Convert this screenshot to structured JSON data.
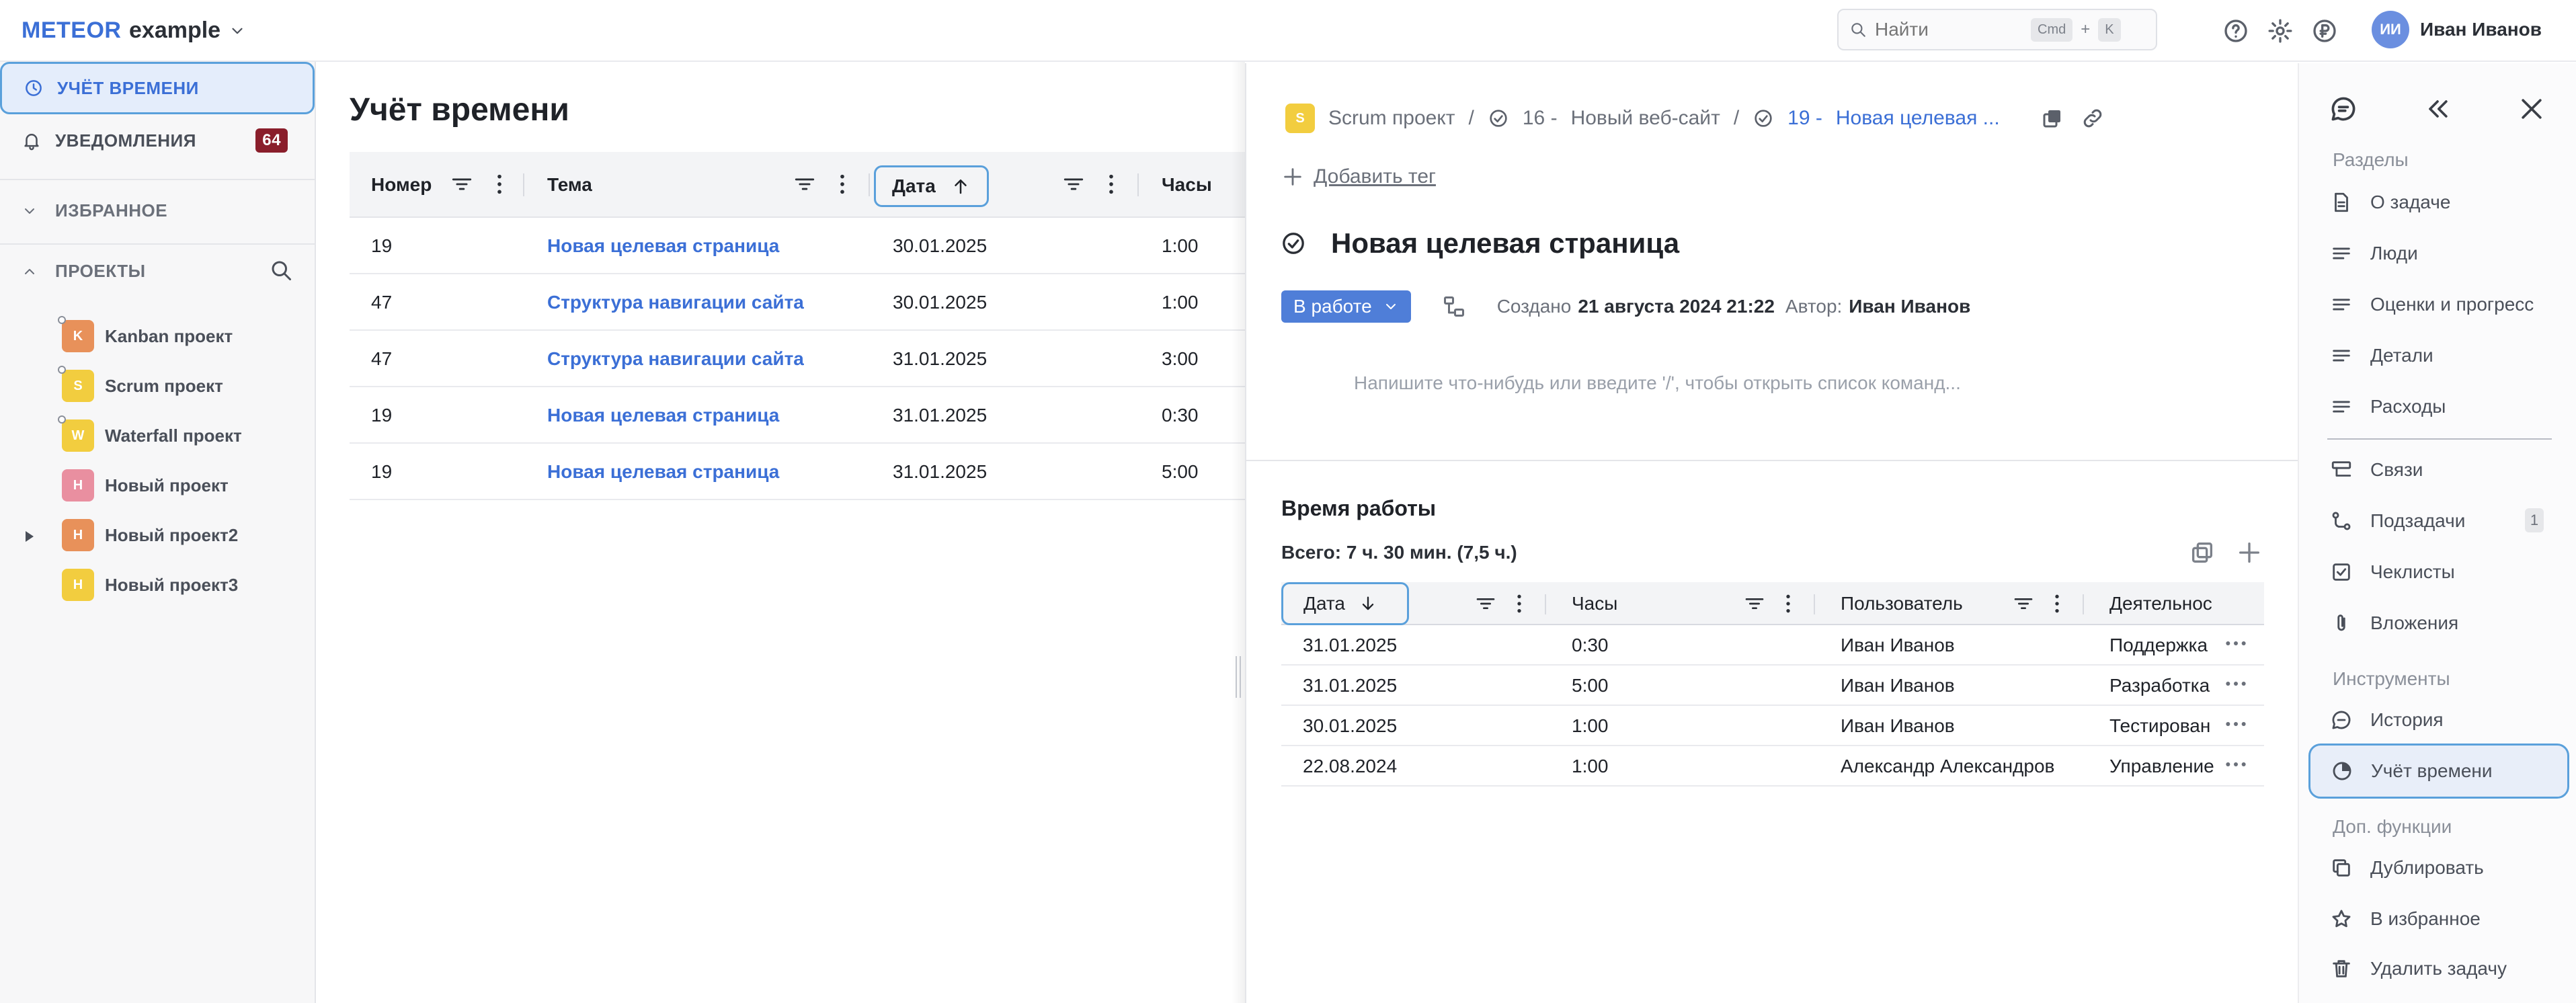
{
  "topbar": {
    "brand": "METEOR",
    "workspace": "example",
    "search_placeholder": "Найти",
    "shortcut_key1": "Cmd",
    "shortcut_plus": "+",
    "shortcut_key2": "K",
    "user_initials": "ИИ",
    "user_name": "Иван Иванов"
  },
  "sidebar": {
    "time_tracking": "УЧЁТ ВРЕМЕНИ",
    "notifications": "УВЕДОМЛЕНИЯ",
    "notifications_count": "64",
    "favorites": "ИЗБРАННОЕ",
    "projects": "ПРОЕКТЫ",
    "project_list": [
      {
        "letter": "K",
        "name": "Kanban проект",
        "color": "#e8915a"
      },
      {
        "letter": "S",
        "name": "Scrum проект",
        "color": "#f2cd3f"
      },
      {
        "letter": "W",
        "name": "Waterfall проект",
        "color": "#f2cd3f"
      },
      {
        "letter": "Н",
        "name": "Новый проект",
        "color": "#e98fa0"
      },
      {
        "letter": "Н",
        "name": "Новый проект2",
        "color": "#e8915a"
      },
      {
        "letter": "Н",
        "name": "Новый проект3",
        "color": "#f2cd3f"
      }
    ]
  },
  "main": {
    "title": "Учёт времени",
    "columns": {
      "number": "Номер",
      "topic": "Тема",
      "date": "Дата",
      "hours": "Часы"
    },
    "rows": [
      {
        "number": "19",
        "topic": "Новая целевая страница",
        "date": "30.01.2025",
        "hours": "1:00"
      },
      {
        "number": "47",
        "topic": "Структура навигации сайта",
        "date": "30.01.2025",
        "hours": "1:00"
      },
      {
        "number": "47",
        "topic": "Структура навигации сайта",
        "date": "31.01.2025",
        "hours": "3:00"
      },
      {
        "number": "19",
        "topic": "Новая целевая страница",
        "date": "31.01.2025",
        "hours": "0:30"
      },
      {
        "number": "19",
        "topic": "Новая целевая страница",
        "date": "31.01.2025",
        "hours": "5:00"
      }
    ]
  },
  "panel": {
    "crumb_project": "Scrum проект",
    "crumb_sep": "/",
    "crumb_parent_num": "16 -",
    "crumb_parent": "Новый веб-сайт",
    "crumb_task_num": "19 -",
    "crumb_task": "Новая целевая ...",
    "add_tag": "Добавить тег",
    "task_title": "Новая целевая страница",
    "status": "В работе",
    "created_label": "Создано",
    "created_value": "21 августа 2024 21:22",
    "author_label": "Автор:",
    "author_value": "Иван Иванов",
    "editor_placeholder": "Напишите что-нибудь или введите '/', чтобы открыть список команд...",
    "time_title": "Время работы",
    "time_total": "Всего: 7 ч. 30 мин. (7,5 ч.)",
    "time_columns": {
      "date": "Дата",
      "hours": "Часы",
      "user": "Пользователь",
      "activity": "Деятельнос"
    },
    "time_rows": [
      {
        "date": "31.01.2025",
        "hours": "0:30",
        "user": "Иван Иванов",
        "activity": "Поддержка"
      },
      {
        "date": "31.01.2025",
        "hours": "5:00",
        "user": "Иван Иванов",
        "activity": "Разработка"
      },
      {
        "date": "30.01.2025",
        "hours": "1:00",
        "user": "Иван Иванов",
        "activity": "Тестирован"
      },
      {
        "date": "22.08.2024",
        "hours": "1:00",
        "user": "Александр Александров",
        "activity": "Управление"
      }
    ]
  },
  "rail": {
    "sections_head": "Разделы",
    "about": "О задаче",
    "people": "Люди",
    "estimates": "Оценки и прогресс",
    "details": "Детали",
    "expenses": "Расходы",
    "links": "Связи",
    "subtasks": "Подзадачи",
    "subtasks_count": "1",
    "checklists": "Чеклисты",
    "attachments": "Вложения",
    "tools_head": "Инструменты",
    "history": "История",
    "time_tracking": "Учёт времени",
    "extra_head": "Доп. функции",
    "duplicate": "Дублировать",
    "favorite": "В избранное",
    "delete": "Удалить задачу"
  }
}
